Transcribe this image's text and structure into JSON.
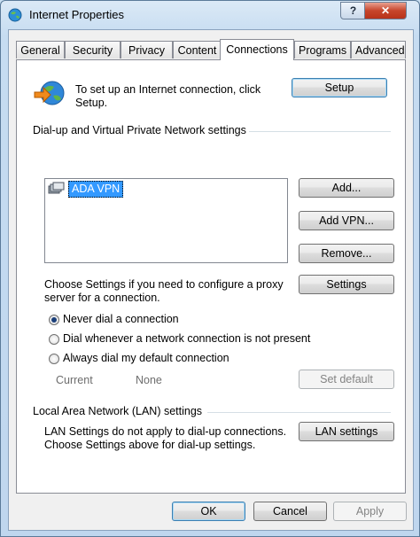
{
  "window": {
    "title": "Internet Properties",
    "help_glyph": "?",
    "close_glyph": "✕"
  },
  "tabs": [
    {
      "label": "General",
      "active": false
    },
    {
      "label": "Security",
      "active": false
    },
    {
      "label": "Privacy",
      "active": false
    },
    {
      "label": "Content",
      "active": false
    },
    {
      "label": "Connections",
      "active": true
    },
    {
      "label": "Programs",
      "active": false
    },
    {
      "label": "Advanced",
      "active": false
    }
  ],
  "setup": {
    "text": "To set up an Internet connection, click Setup.",
    "button": "Setup"
  },
  "dialup": {
    "heading": "Dial-up and Virtual Private Network settings",
    "items": [
      {
        "label": "ADA VPN",
        "selected": true
      }
    ],
    "add_button": "Add...",
    "add_vpn_button": "Add VPN...",
    "remove_button": "Remove..."
  },
  "proxy": {
    "text": "Choose Settings if you need to configure a proxy server for a connection.",
    "settings_button": "Settings"
  },
  "dial_options": [
    {
      "label": "Never dial a connection",
      "checked": true
    },
    {
      "label": "Dial whenever a network connection is not present",
      "checked": false
    },
    {
      "label": "Always dial my default connection",
      "checked": false
    }
  ],
  "current": {
    "label": "Current",
    "value": "None",
    "set_default_button": "Set default"
  },
  "lan": {
    "heading": "Local Area Network (LAN) settings",
    "text": "LAN Settings do not apply to dial-up connections. Choose Settings above for dial-up settings.",
    "button": "LAN settings"
  },
  "footer": {
    "ok": "OK",
    "cancel": "Cancel",
    "apply": "Apply"
  },
  "icons": {
    "app": "internet-globe-icon",
    "setup": "connection-wizard-icon",
    "vpn": "network-connection-icon"
  }
}
